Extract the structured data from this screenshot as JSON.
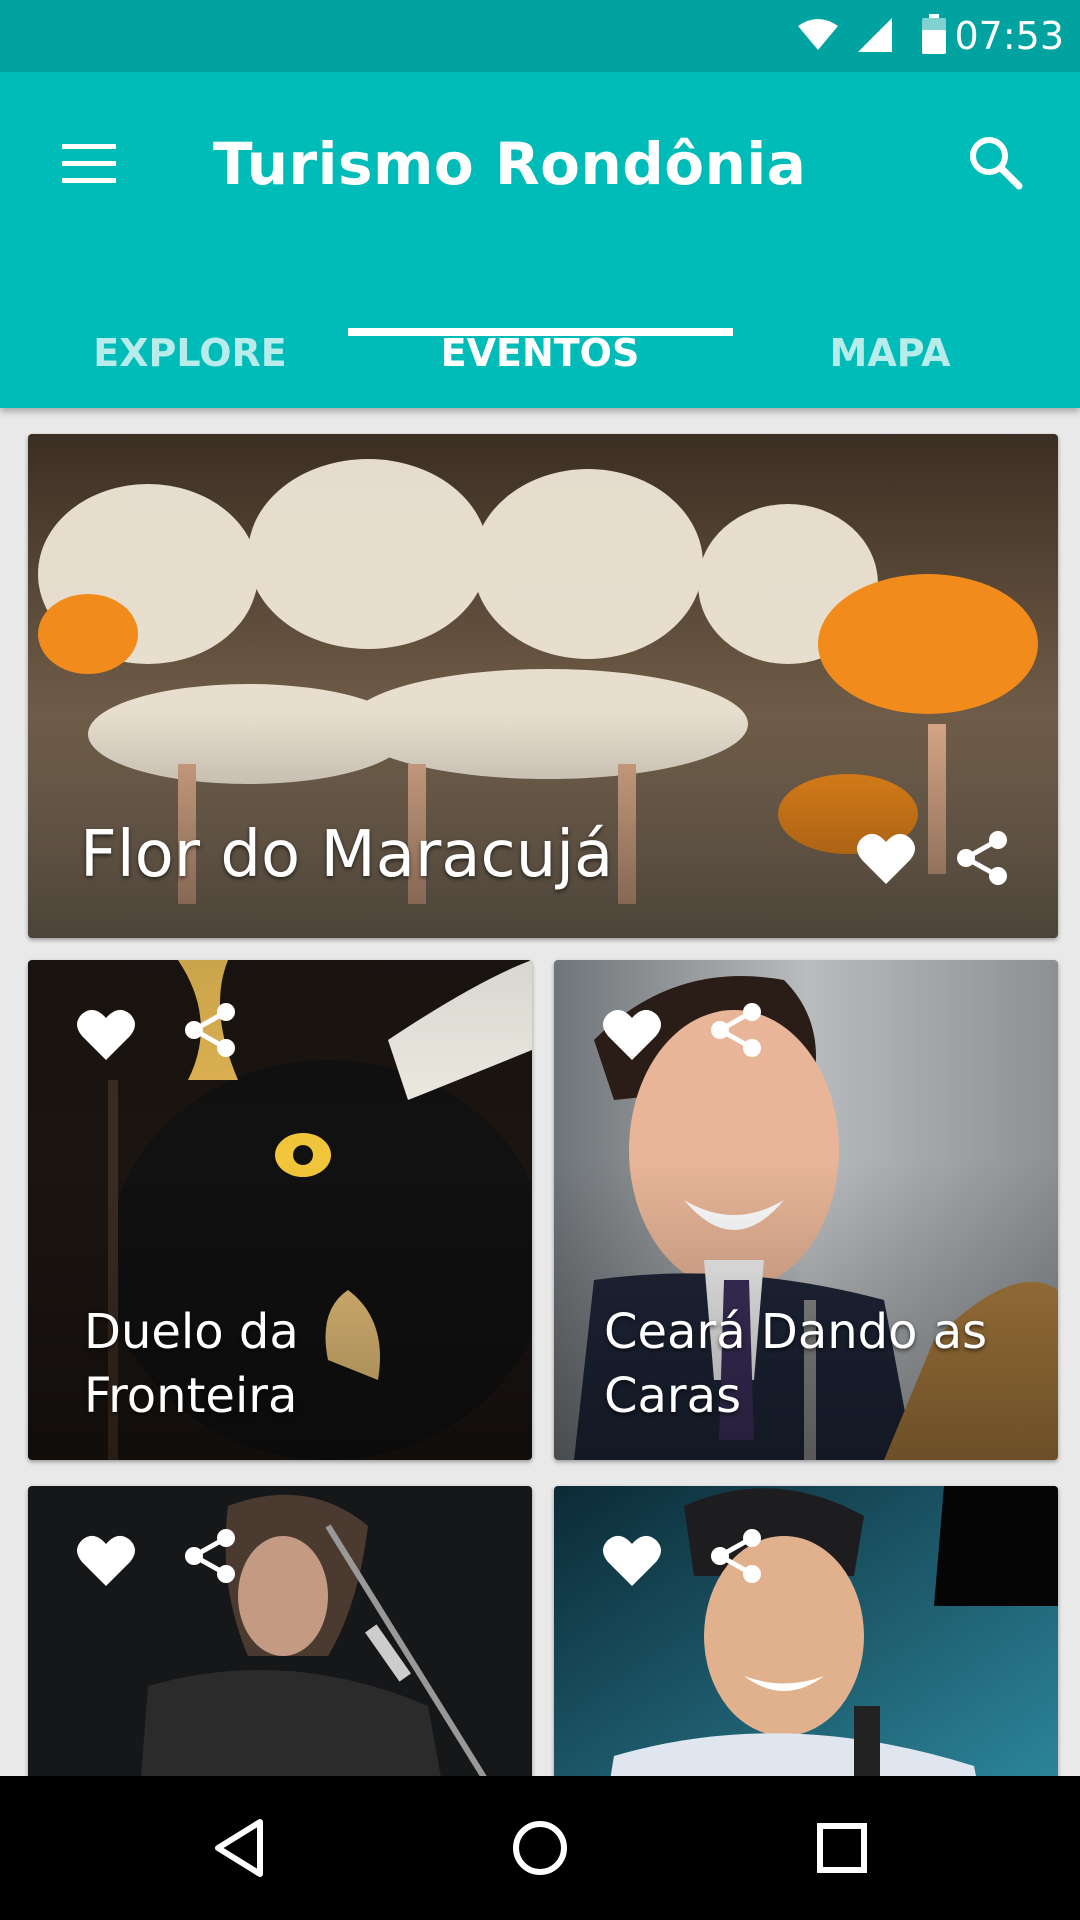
{
  "status_bar": {
    "time": "07:53"
  },
  "app": {
    "title": "Turismo Rondônia"
  },
  "tabs": [
    {
      "label": "EXPLORE"
    },
    {
      "label": "EVENTOS"
    },
    {
      "label": "MAPA"
    }
  ],
  "active_tab": "EVENTOS",
  "events": [
    {
      "title": "Flor do Maracujá"
    },
    {
      "title": "Duelo da Fronteira"
    },
    {
      "title": "Ceará Dando as Caras"
    },
    {
      "title": ""
    },
    {
      "title": ""
    }
  ],
  "colors": {
    "primary": "#00bcb8",
    "primary_dark": "#00a3a0",
    "accent": "#ffffff"
  },
  "icons": {
    "menu": "menu-icon",
    "search": "search-icon",
    "favorite": "heart-icon",
    "share": "share-icon",
    "nav_back": "back-icon",
    "nav_home": "home-icon",
    "nav_recents": "recents-icon"
  }
}
